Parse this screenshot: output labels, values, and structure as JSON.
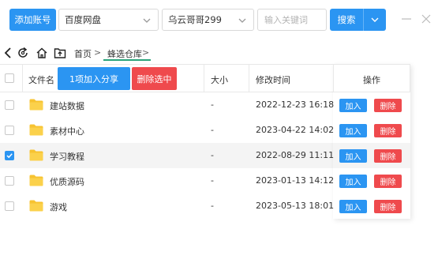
{
  "toolbar": {
    "add_account_label": "添加账号",
    "drive_select_value": "百度网盘",
    "user_select_value": "乌云哥哥299",
    "search_placeholder": "输入关键词",
    "search_label": "搜索"
  },
  "breadcrumb": {
    "home": "首页",
    "separator": ">",
    "current": "蜂选仓库"
  },
  "table": {
    "headers": {
      "filename": "文件名",
      "size": "大小",
      "modified": "修改时间",
      "actions": "操作"
    },
    "batch_share_label": "1项加入分享",
    "batch_delete_label": "删除选中",
    "add_label": "加入",
    "delete_label": "删除",
    "rows": [
      {
        "name": "建站数据",
        "size": "-",
        "modified": "2022-12-23 16:18",
        "checked": false
      },
      {
        "name": "素材中心",
        "size": "-",
        "modified": "2023-04-22 14:02",
        "checked": false
      },
      {
        "name": "学习教程",
        "size": "-",
        "modified": "2022-08-29 11:11",
        "checked": true
      },
      {
        "name": "优质源码",
        "size": "-",
        "modified": "2023-01-13 14:12",
        "checked": false
      },
      {
        "name": "游戏",
        "size": "-",
        "modified": "2023-05-13 18:01",
        "checked": false
      }
    ]
  },
  "colors": {
    "primary": "#2b95f2",
    "danger": "#ef4a4d",
    "folder": "#f7c331",
    "accent_underline": "#2aa37a"
  },
  "icons": [
    "back-icon",
    "refresh-icon",
    "home-icon",
    "upload-folder-icon",
    "chevron-down-icon",
    "minimize-icon",
    "close-icon",
    "folder-icon",
    "check-icon"
  ]
}
